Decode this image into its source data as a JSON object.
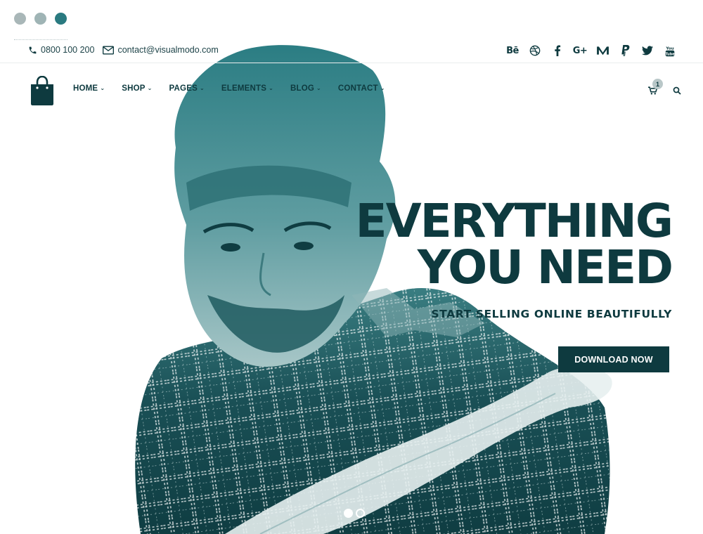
{
  "window_dots": [
    {
      "color": "#a9b7b8"
    },
    {
      "color": "#9fb4b5"
    },
    {
      "color": "#2a7a80"
    }
  ],
  "topbar": {
    "phone": "0800 100 200",
    "email": "contact@visualmodo.com",
    "social_icons": [
      "behance-icon",
      "dribbble-icon",
      "facebook-icon",
      "google-plus-icon",
      "medium-icon",
      "paypal-icon",
      "twitter-icon",
      "youtube-icon"
    ],
    "behance_text": "Bē",
    "gplus_text": "G+"
  },
  "nav": {
    "items": [
      {
        "label": "HOME"
      },
      {
        "label": "SHOP"
      },
      {
        "label": "PAGES"
      },
      {
        "label": "ELEMENTS"
      },
      {
        "label": "BLOG"
      },
      {
        "label": "CONTACT"
      }
    ],
    "cart_count": "1"
  },
  "hero": {
    "line1": "EVERYTHING",
    "line2": "YOU NEED",
    "subtitle": "START SELLING ONLINE BEAUTIFULLY",
    "cta_label": "DOWNLOAD NOW",
    "slides": 2,
    "active_slide": 1
  },
  "colors": {
    "primary": "#0e3a3f",
    "teal": "#2a7a80",
    "light": "#b9c7c8"
  }
}
